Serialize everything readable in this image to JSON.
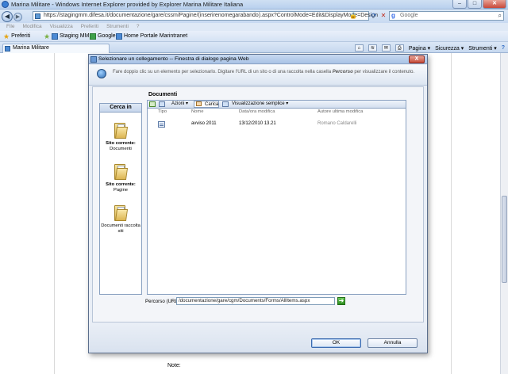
{
  "browser": {
    "window_title": "Marina Militare - Windows Internet Explorer provided by Explorer Marina Militare Italiana",
    "window_buttons": {
      "minimize": "–",
      "maximize": "□",
      "close": "✕"
    },
    "url": "https://stagingmm.difesa.it/documentazione/gare/cssm/Pagine/(inserirenomegarabando).aspx?ControlMode=Edit&DisplayMode=Design",
    "search_placeholder": "Google",
    "search_engine_glyph": "g",
    "menu": [
      "File",
      "Modifica",
      "Visualizza",
      "Preferiti",
      "Strumenti",
      "?"
    ],
    "favorites_label": "Preferiti",
    "favorites_links": [
      "Staging MM",
      "Google",
      "Home Portale Marintranet"
    ],
    "tab_label": "Marina Militare",
    "command_bar": [
      "Pagina ▾",
      "Sicurezza ▾",
      "Strumenti ▾"
    ],
    "help_glyph": "?"
  },
  "page": {
    "note_label": "Note:"
  },
  "dialog": {
    "title": "Selezionare un collegamento -- Finestra di dialogo pagina Web",
    "close_glyph": "X",
    "info_text_before": "Fare doppio clic su un elemento per selezionarlo. Digitare l'URL di un sito o di una raccolta nella casella ",
    "info_text_emph": "Percorso",
    "info_text_after": " per visualizzare il contenuto.",
    "look_in": {
      "title": "Cerca in",
      "locations": [
        {
          "bold": "Sito corrente:",
          "label": "Documenti"
        },
        {
          "bold": "Sito corrente:",
          "label": "Pagine"
        },
        {
          "bold": "",
          "label": "Documenti raccolta siti"
        }
      ]
    },
    "docpane_title": "Documenti",
    "toolbar": {
      "actions": "Azioni",
      "upload": "Carica",
      "view": "Visualizzazione semplice",
      "dropdown_glyph": "▾"
    },
    "columns": [
      "Tipo",
      "Nome",
      "Data/ora modifica",
      "Autore ultima modifica"
    ],
    "rows": [
      {
        "type_icon": "document-icon",
        "name": "avviso 2011",
        "modified": "13/12/2010 13.21",
        "author": "Romano Caldarelli"
      }
    ],
    "path_label": "Percorso (URL):",
    "path_value": "/documentazione/gare/cgm/Documents/Forms/AllItems.aspx",
    "go_glyph": "➜",
    "ok_label": "OK",
    "cancel_label": "Annulla"
  },
  "colors": {
    "title_bar": "#b8d0ee",
    "dialog_bg": "#e9eef6",
    "close_red": "#c54a38",
    "go_green": "#2b8c1e",
    "folder_yellow": "#dcb552"
  }
}
